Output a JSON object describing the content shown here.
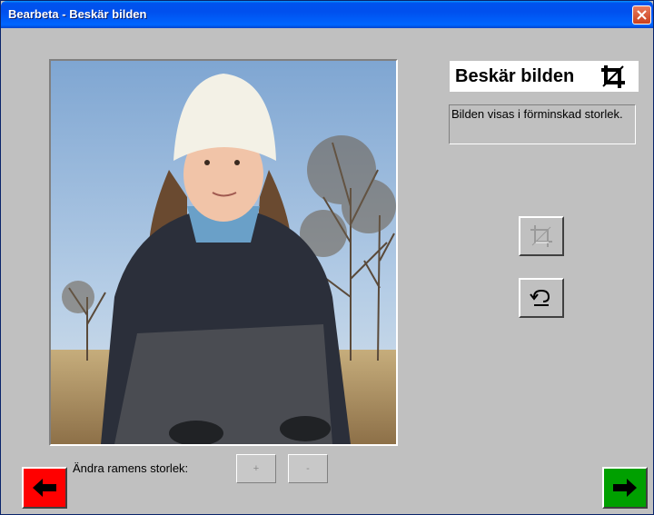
{
  "window": {
    "title": "Bearbeta - Beskär bilden"
  },
  "heading": {
    "text": "Beskär bilden",
    "icon": "crop-icon"
  },
  "info": {
    "text": "Bilden visas i förminskad storlek."
  },
  "tools": {
    "crop_icon": "crop-icon",
    "undo_icon": "undo-icon",
    "crop_enabled": false
  },
  "frame_size": {
    "label": "Ändra ramens storlek:",
    "plus_label": "+",
    "minus_label": "-"
  },
  "navigation": {
    "back_icon": "arrow-left-icon",
    "next_icon": "arrow-right-icon",
    "back_color": "#ff0000",
    "next_color": "#00a000"
  },
  "colors": {
    "titlebar": "#0055ea",
    "background": "#c0c0c0"
  }
}
